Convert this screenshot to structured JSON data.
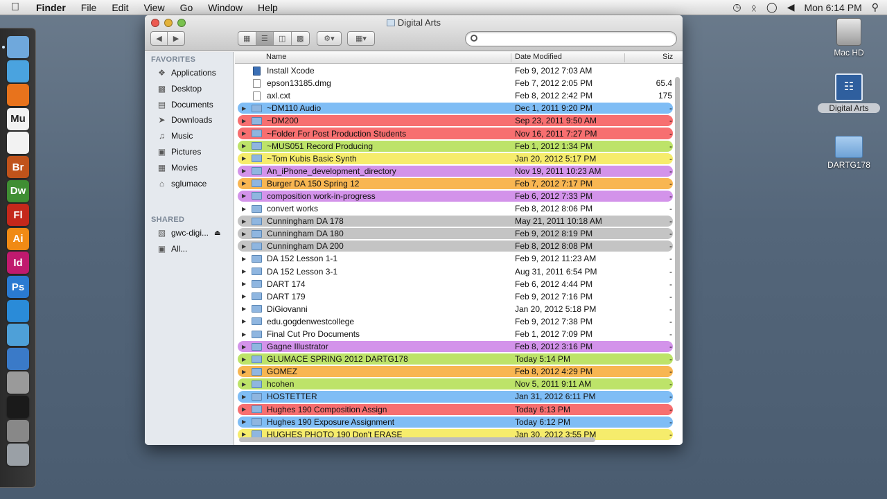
{
  "menubar": {
    "app": "Finder",
    "menus": [
      "File",
      "Edit",
      "View",
      "Go",
      "Window",
      "Help"
    ],
    "clock": "Mon 6:14 PM"
  },
  "desktop": {
    "icons": [
      {
        "label": "Mac HD"
      },
      {
        "label": "Digital Arts"
      },
      {
        "label": "DARTG178"
      }
    ]
  },
  "window": {
    "title": "Digital Arts",
    "search_placeholder": ""
  },
  "sidebar": {
    "favorites_header": "FAVORITES",
    "favorites": [
      {
        "label": "Applications",
        "icon": "applications-icon"
      },
      {
        "label": "Desktop",
        "icon": "desktop-icon"
      },
      {
        "label": "Documents",
        "icon": "documents-icon"
      },
      {
        "label": "Downloads",
        "icon": "downloads-icon"
      },
      {
        "label": "Music",
        "icon": "music-icon"
      },
      {
        "label": "Pictures",
        "icon": "pictures-icon"
      },
      {
        "label": "Movies",
        "icon": "movies-icon"
      },
      {
        "label": "sglumace",
        "icon": "home-icon"
      }
    ],
    "shared_header": "SHARED",
    "shared": [
      {
        "label": "gwc-digi...",
        "icon": "server-icon"
      },
      {
        "label": "All...",
        "icon": "network-icon"
      }
    ]
  },
  "columns": {
    "name": "Name",
    "date": "Date Modified",
    "size": "Siz"
  },
  "label_colors": {
    "blue": "#7fbdf5",
    "red": "#f76f70",
    "green": "#bde369",
    "yellow": "#f6ec6c",
    "purple": "#d393ea",
    "orange": "#f8b652",
    "gray": "#c4c4c4",
    "none": ""
  },
  "files": [
    {
      "name": "Install Xcode",
      "date": "Feb 9, 2012 7:03 AM",
      "size": "",
      "label": "none",
      "kind": "app"
    },
    {
      "name": "epson13185.dmg",
      "date": "Feb 7, 2012 2:05 PM",
      "size": "65.4",
      "label": "none",
      "kind": "doc"
    },
    {
      "name": "axl.cxt",
      "date": "Feb 8, 2012 2:42 PM",
      "size": "175",
      "label": "none",
      "kind": "doc"
    },
    {
      "name": "~DM110 Audio",
      "date": "Dec 1, 2011 9:20 PM",
      "size": "-",
      "label": "blue",
      "kind": "folder"
    },
    {
      "name": "~DM200",
      "date": "Sep 23, 2011 9:50 AM",
      "size": "-",
      "label": "red",
      "kind": "folder"
    },
    {
      "name": "~Folder For Post Production Students",
      "date": "Nov 16, 2011 7:27 PM",
      "size": "-",
      "label": "red",
      "kind": "folder"
    },
    {
      "name": "~MUS051 Record Producing",
      "date": "Feb 1, 2012 1:34 PM",
      "size": "-",
      "label": "green",
      "kind": "folder"
    },
    {
      "name": "~Tom Kubis Basic Synth",
      "date": "Jan 20, 2012 5:17 PM",
      "size": "-",
      "label": "yellow",
      "kind": "folder"
    },
    {
      "name": "An_iPhone_development_directory",
      "date": "Nov 19, 2011 10:23 AM",
      "size": "-",
      "label": "purple",
      "kind": "folder"
    },
    {
      "name": "Burger DA 150 Spring 12",
      "date": "Feb 7, 2012 7:17 PM",
      "size": "-",
      "label": "orange",
      "kind": "folder"
    },
    {
      "name": "composition work-in-progress",
      "date": "Feb 6, 2012 7:33 PM",
      "size": "-",
      "label": "purple",
      "kind": "folder"
    },
    {
      "name": "convert works",
      "date": "Feb 8, 2012 8:06 PM",
      "size": "-",
      "label": "none",
      "kind": "folder"
    },
    {
      "name": "Cunningham DA 178",
      "date": "May 21, 2011 10:18 AM",
      "size": "-",
      "label": "gray",
      "kind": "folder"
    },
    {
      "name": "Cunningham DA 180",
      "date": "Feb 9, 2012 8:19 PM",
      "size": "-",
      "label": "gray",
      "kind": "folder"
    },
    {
      "name": "Cunningham DA 200",
      "date": "Feb 8, 2012 8:08 PM",
      "size": "-",
      "label": "gray",
      "kind": "folder"
    },
    {
      "name": "DA 152 Lesson 1-1",
      "date": "Feb 9, 2012 11:23 AM",
      "size": "-",
      "label": "none",
      "kind": "folder"
    },
    {
      "name": "DA 152 Lesson 3-1",
      "date": "Aug 31, 2011 6:54 PM",
      "size": "-",
      "label": "none",
      "kind": "folder"
    },
    {
      "name": "DART 174",
      "date": "Feb 6, 2012 4:44 PM",
      "size": "-",
      "label": "none",
      "kind": "folder"
    },
    {
      "name": "DART 179",
      "date": "Feb 9, 2012 7:16 PM",
      "size": "-",
      "label": "none",
      "kind": "folder"
    },
    {
      "name": "DiGiovanni",
      "date": "Jan 20, 2012 5:18 PM",
      "size": "-",
      "label": "none",
      "kind": "folder"
    },
    {
      "name": "edu.gogdenwestcollege",
      "date": "Feb 9, 2012 7:38 PM",
      "size": "-",
      "label": "none",
      "kind": "folder"
    },
    {
      "name": "Final Cut Pro Documents",
      "date": "Feb 1, 2012 7:09 PM",
      "size": "-",
      "label": "none",
      "kind": "folder"
    },
    {
      "name": "Gagne Illustrator",
      "date": "Feb 8, 2012 3:16 PM",
      "size": "-",
      "label": "purple",
      "kind": "folder"
    },
    {
      "name": "GLUMACE SPRING 2012 DARTG178",
      "date": "Today 5:14 PM",
      "size": "-",
      "label": "green",
      "kind": "folder"
    },
    {
      "name": "GOMEZ",
      "date": "Feb 8, 2012 4:29 PM",
      "size": "-",
      "label": "orange",
      "kind": "folder"
    },
    {
      "name": "hcohen",
      "date": "Nov 5, 2011 9:11 AM",
      "size": "-",
      "label": "green",
      "kind": "folder"
    },
    {
      "name": "HOSTETTER",
      "date": "Jan 31, 2012 6:11 PM",
      "size": "-",
      "label": "blue",
      "kind": "folder"
    },
    {
      "name": "Hughes 190 Composition Assign",
      "date": "Today 6:13 PM",
      "size": "-",
      "label": "red",
      "kind": "folder"
    },
    {
      "name": "Hughes 190 Exposure Assignment",
      "date": "Today 6:12 PM",
      "size": "-",
      "label": "blue",
      "kind": "folder"
    },
    {
      "name": "HUGHES PHOTO 190 Don't ERASE",
      "date": "Jan 30, 2012 3:55 PM",
      "size": "-",
      "label": "yellow",
      "kind": "folder"
    }
  ],
  "dock": {
    "apps": [
      {
        "name": "finder-icon",
        "text": "",
        "color": "#6fa8dc"
      },
      {
        "name": "safari-icon",
        "text": "",
        "color": "#4aa3df"
      },
      {
        "name": "firefox-icon",
        "text": "",
        "color": "#e8731c"
      },
      {
        "name": "muse-icon",
        "text": "Mu",
        "color": "#f2f2f2"
      },
      {
        "name": "acrobat-icon",
        "text": "",
        "color": "#f2f2f2"
      },
      {
        "name": "bridge-icon",
        "text": "Br",
        "color": "#c0531b"
      },
      {
        "name": "dreamweaver-icon",
        "text": "Dw",
        "color": "#3f8e33"
      },
      {
        "name": "flash-icon",
        "text": "Fl",
        "color": "#c4281b"
      },
      {
        "name": "illustrator-icon",
        "text": "Ai",
        "color": "#f08a14"
      },
      {
        "name": "indesign-icon",
        "text": "Id",
        "color": "#c01a6e"
      },
      {
        "name": "photoshop-icon",
        "text": "Ps",
        "color": "#2a7ad1"
      },
      {
        "name": "wave-app-icon",
        "text": "",
        "color": "#2a8bd8"
      },
      {
        "name": "spinning-app-icon",
        "text": "",
        "color": "#4ea0d8"
      },
      {
        "name": "xcode-icon",
        "text": "",
        "color": "#3a7ac8"
      },
      {
        "name": "utility-icon",
        "text": "",
        "color": "#9a9a9a"
      },
      {
        "name": "terminal-icon",
        "text": "",
        "color": "#1a1a1a"
      },
      {
        "name": "preferences-icon",
        "text": "",
        "color": "#888888"
      },
      {
        "name": "trash-icon",
        "text": "",
        "color": "#9aa0a6"
      }
    ]
  }
}
